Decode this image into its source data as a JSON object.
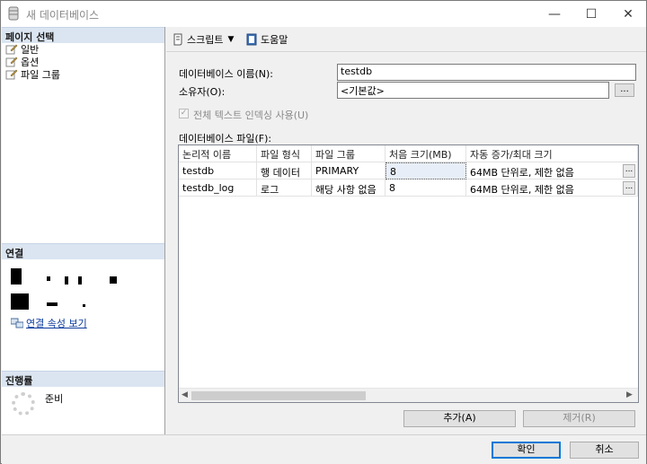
{
  "window": {
    "title": "새 데이터베이스",
    "minimize": "—",
    "maximize": "☐",
    "close": "✕"
  },
  "left": {
    "page_select_header": "페이지 선택",
    "pages": [
      {
        "label": "일반"
      },
      {
        "label": "옵션"
      },
      {
        "label": "파일 그룹"
      }
    ],
    "connection_header": "연결",
    "connection_link": "연결 속성 보기",
    "progress_header": "진행률",
    "progress_status": "준비"
  },
  "toolbar": {
    "script_label": "스크립트",
    "help_label": "도움말"
  },
  "form": {
    "db_name_label": "데이터베이스 이름(N):",
    "db_name_value": "testdb",
    "owner_label": "소유자(O):",
    "owner_value": "<기본값>",
    "ellipsis": "...",
    "fulltext_label": "전체 텍스트 인덱싱 사용(U)",
    "fulltext_checked": true,
    "files_label": "데이터베이스 파일(F):"
  },
  "files_table": {
    "columns": [
      "논리적 이름",
      "파일 형식",
      "파일 그룹",
      "처음 크기(MB)",
      "자동 증가/최대 크기"
    ],
    "rows": [
      [
        "testdb",
        "행 데이터",
        "PRIMARY",
        "8",
        "64MB 단위로, 제한 없음"
      ],
      [
        "testdb_log",
        "로그",
        "해당 사항 없음",
        "8",
        "64MB 단위로, 제한 없음"
      ]
    ]
  },
  "buttons": {
    "add": "추가(A)",
    "remove": "제거(R)",
    "ok": "확인",
    "cancel": "취소"
  }
}
